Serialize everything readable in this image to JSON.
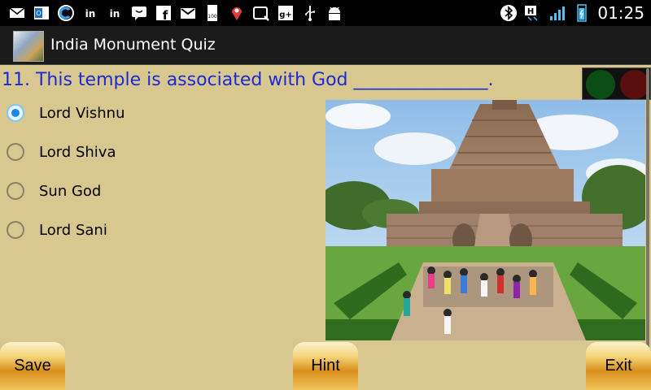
{
  "status_bar": {
    "time": "01:25",
    "notification_icons": [
      "mail-icon",
      "outlook-icon",
      "circle-c-icon",
      "linkedin-icon",
      "linkedin-icon",
      "chat-icon",
      "facebook-icon",
      "gmail-icon",
      "battery-100-icon",
      "location-pin-icon",
      "search-box-icon",
      "google-plus-icon",
      "usb-icon",
      "android-icon"
    ],
    "battery_label": "100",
    "network_label": "H"
  },
  "app": {
    "title": "India Monument Quiz"
  },
  "question": {
    "text": "11. This temple is associated with God _______________."
  },
  "options": [
    {
      "label": "Lord Vishnu",
      "selected": true
    },
    {
      "label": "Lord Shiva",
      "selected": false
    },
    {
      "label": "Sun God",
      "selected": false
    },
    {
      "label": "Lord Sani",
      "selected": false
    }
  ],
  "buttons": {
    "save": "Save",
    "hint": "Hint",
    "exit": "Exit"
  },
  "colors": {
    "background": "#d8c88f",
    "question": "#1b2ad6",
    "radio_selected": "#1e88e5"
  }
}
